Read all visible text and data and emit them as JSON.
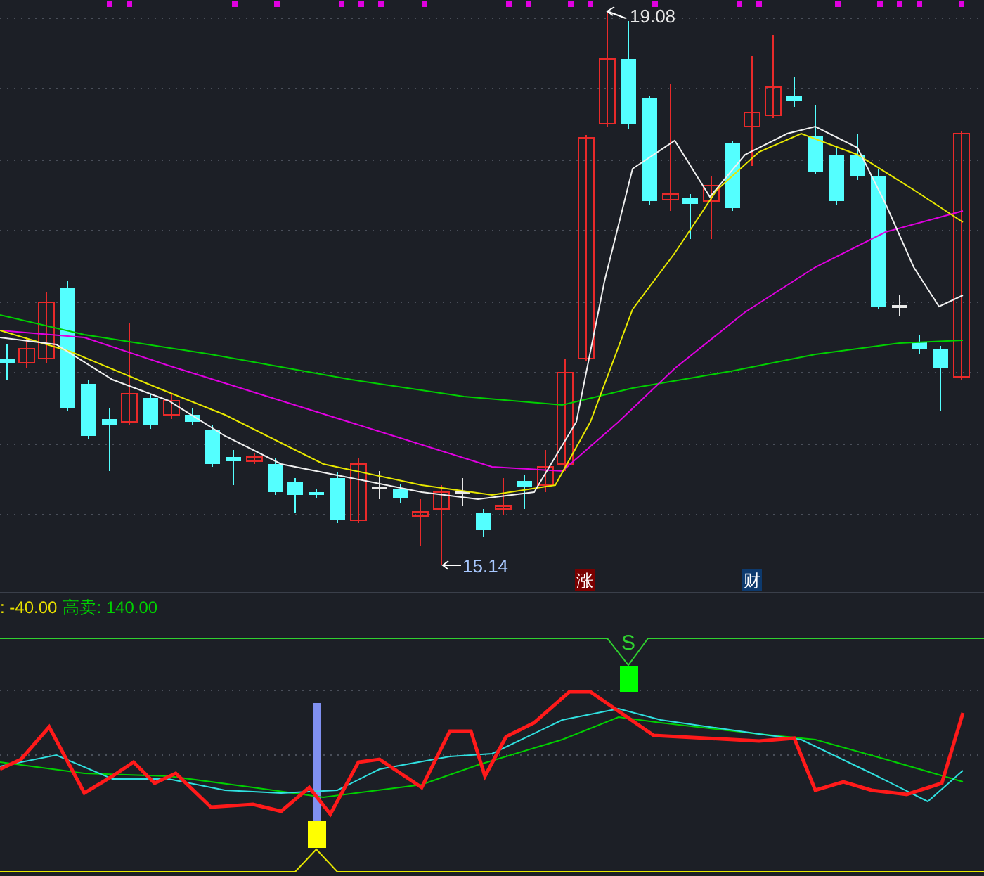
{
  "price_chart": {
    "high_label": "19.08",
    "low_label": "15.14",
    "event_markers": [
      {
        "label": "涨",
        "color": "#7a0000"
      },
      {
        "label": "财",
        "color": "#0d3a6e"
      }
    ]
  },
  "indicator": {
    "legend": [
      {
        "text": ": -40.00",
        "color": "#e8e000"
      },
      {
        "text": "高卖: 140.00",
        "color": "#00d000"
      }
    ],
    "sell_signal": "S"
  }
}
